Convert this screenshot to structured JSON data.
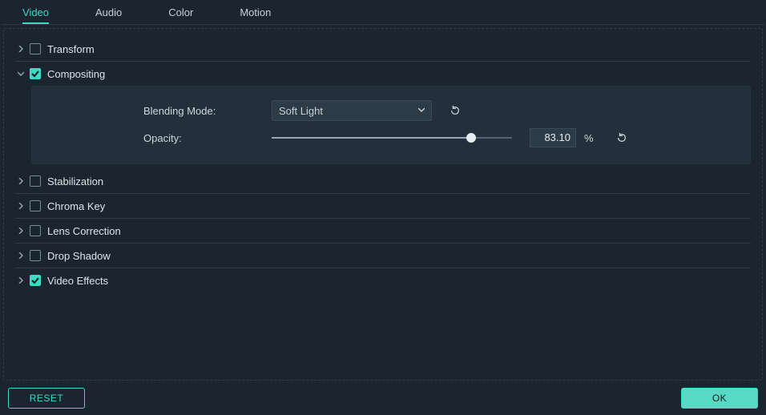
{
  "tabs": {
    "video": "Video",
    "audio": "Audio",
    "color": "Color",
    "motion": "Motion",
    "active": "video"
  },
  "sections": {
    "transform": {
      "label": "Transform",
      "checked": false,
      "expanded": false
    },
    "compositing": {
      "label": "Compositing",
      "checked": true,
      "expanded": true
    },
    "stabilization": {
      "label": "Stabilization",
      "checked": false,
      "expanded": false
    },
    "chroma_key": {
      "label": "Chroma Key",
      "checked": false,
      "expanded": false
    },
    "lens_correction": {
      "label": "Lens Correction",
      "checked": false,
      "expanded": false
    },
    "drop_shadow": {
      "label": "Drop Shadow",
      "checked": false,
      "expanded": false
    },
    "video_effects": {
      "label": "Video Effects",
      "checked": true,
      "expanded": false
    }
  },
  "compositing": {
    "blending_label": "Blending Mode:",
    "blending_value": "Soft Light",
    "opacity_label": "Opacity:",
    "opacity_value": "83.10",
    "opacity_unit": "%"
  },
  "footer": {
    "reset": "RESET",
    "ok": "OK"
  },
  "colors": {
    "accent": "#3ed8c3",
    "bg": "#1a2530",
    "panel": "#232f3a"
  }
}
